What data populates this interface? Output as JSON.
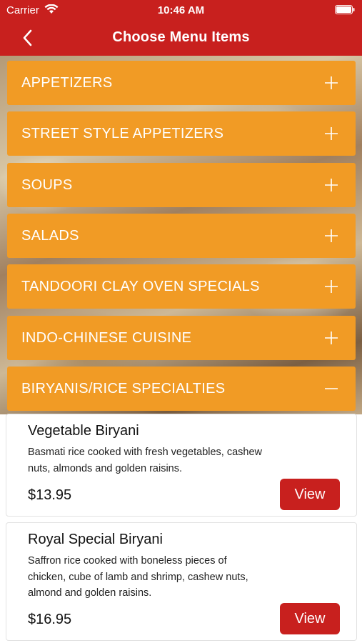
{
  "status_bar": {
    "carrier": "Carrier",
    "time": "10:46 AM"
  },
  "nav": {
    "title": "Choose Menu Items",
    "back_icon": "chevron-left-icon"
  },
  "colors": {
    "header_red": "#c8201e",
    "category_orange": "#f19b25",
    "view_button_red": "#c8201e"
  },
  "categories": [
    {
      "label": "APPETIZERS",
      "expanded": false,
      "icon": "plus-icon"
    },
    {
      "label": "STREET STYLE APPETIZERS",
      "expanded": false,
      "icon": "plus-icon"
    },
    {
      "label": "SOUPS",
      "expanded": false,
      "icon": "plus-icon"
    },
    {
      "label": "SALADS",
      "expanded": false,
      "icon": "plus-icon"
    },
    {
      "label": "TANDOORI CLAY OVEN SPECIALS",
      "expanded": false,
      "icon": "plus-icon"
    },
    {
      "label": "INDO-CHINESE CUISINE",
      "expanded": false,
      "icon": "plus-icon"
    },
    {
      "label": "BIRYANIS/RICE SPECIALTIES",
      "expanded": true,
      "icon": "minus-icon"
    }
  ],
  "items": [
    {
      "name": "Vegetable Biryani",
      "desc_lines": [
        "Basmati rice cooked with fresh vegetables, cashew",
        "nuts, almonds and golden raisins."
      ],
      "price": "$13.95",
      "button": "View"
    },
    {
      "name": "Royal Special Biryani",
      "desc_lines": [
        "Saffron rice cooked with boneless pieces of",
        "chicken, cube of lamb and shrimp, cashew nuts,",
        "almond and golden raisins."
      ],
      "price": "$16.95",
      "button": "View"
    }
  ]
}
